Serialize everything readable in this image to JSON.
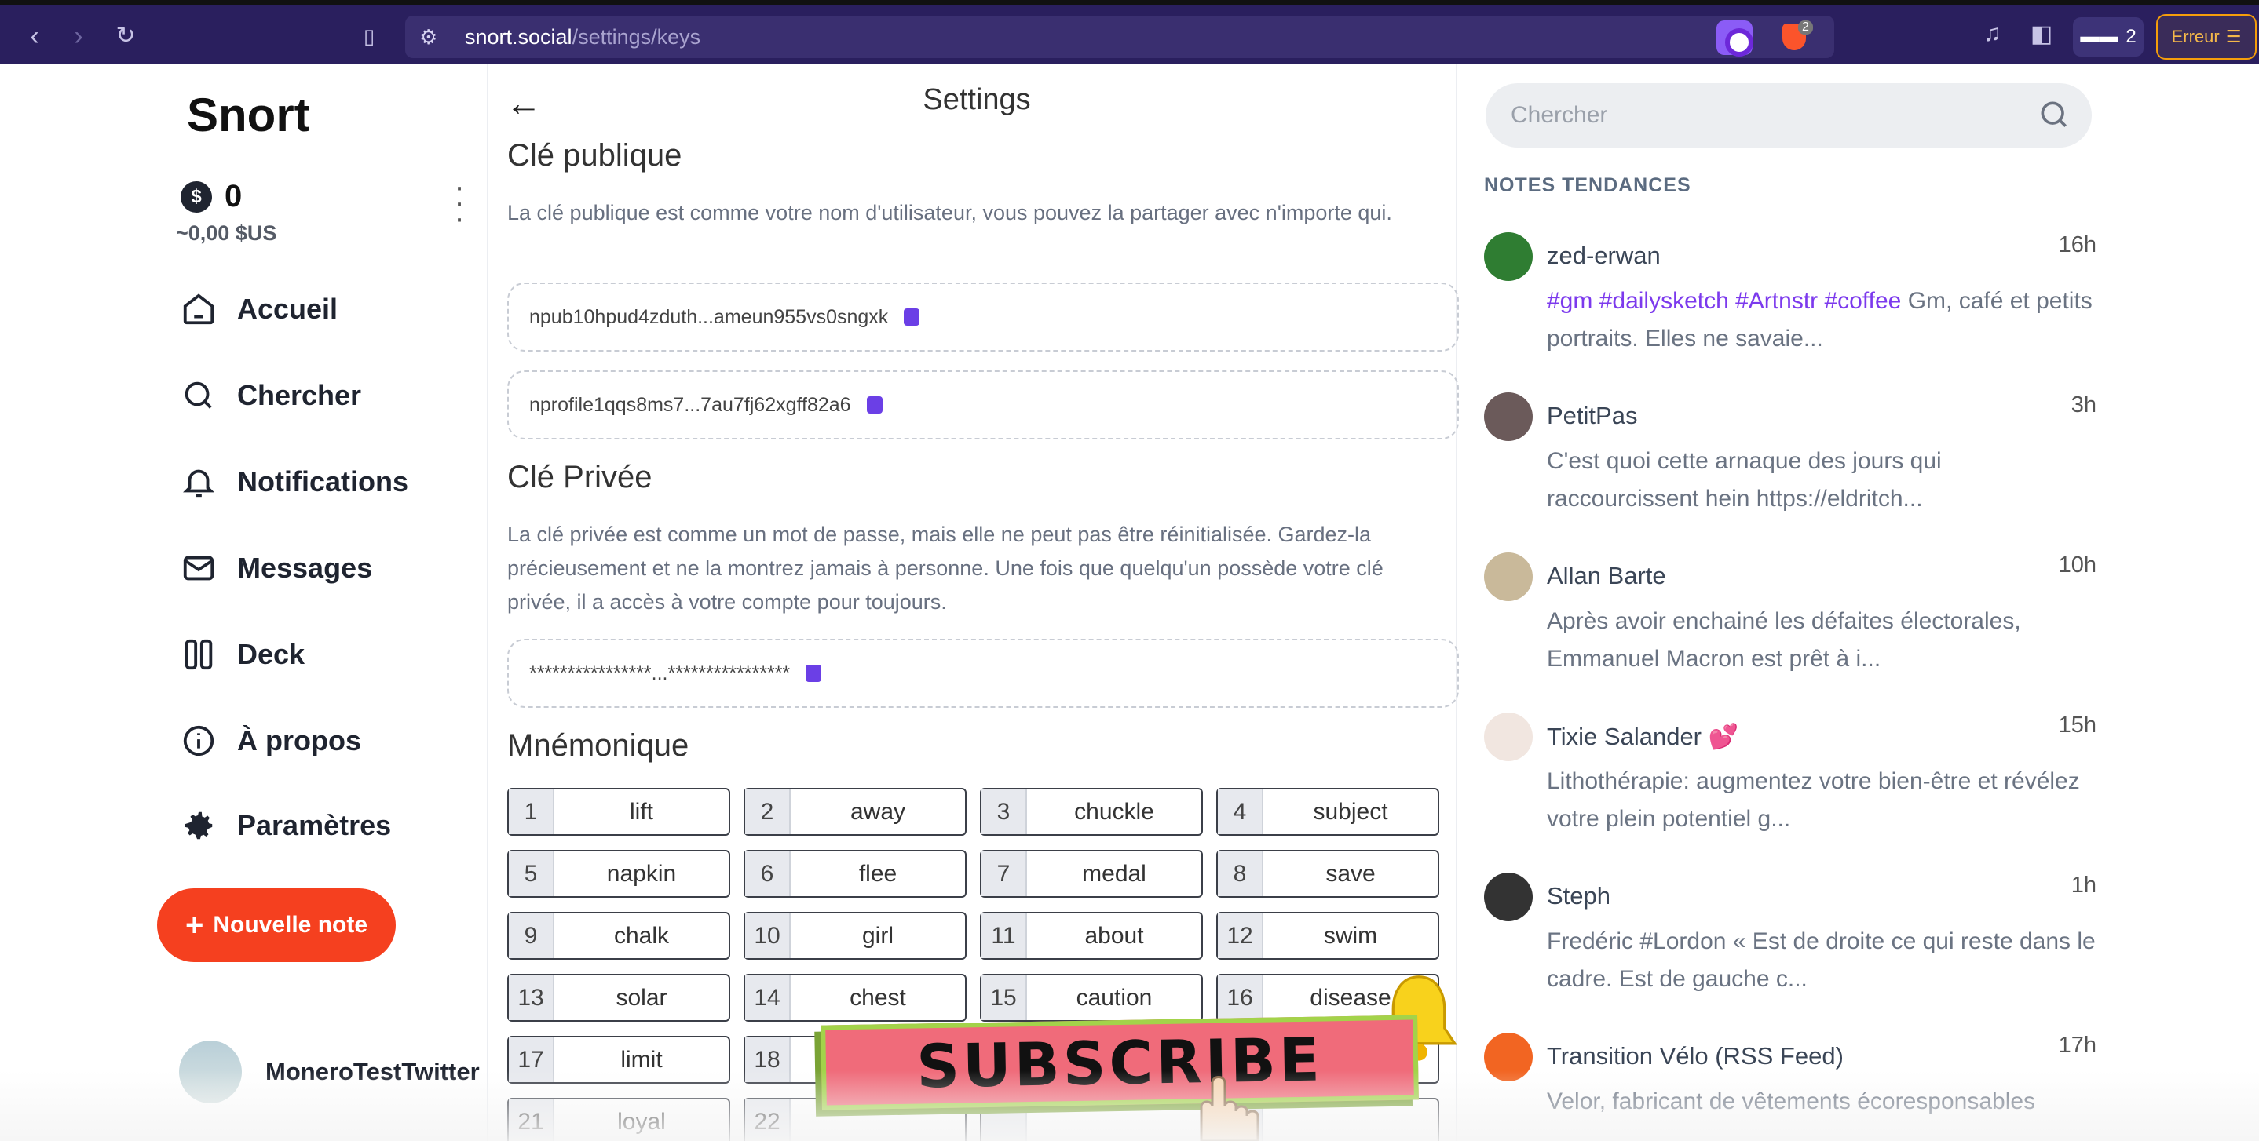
{
  "browser": {
    "url_host": "snort.social",
    "url_path": "/settings/keys",
    "brave_shield_count": "2",
    "wallet_count": "2",
    "error_label": "Erreur"
  },
  "sidebar": {
    "logo": "Snort",
    "balance": "0",
    "balance_fiat": "~0,00 $US",
    "items": [
      {
        "label": "Accueil",
        "icon": "home-icon"
      },
      {
        "label": "Chercher",
        "icon": "search-icon"
      },
      {
        "label": "Notifications",
        "icon": "bell-icon"
      },
      {
        "label": "Messages",
        "icon": "mail-icon"
      },
      {
        "label": "Deck",
        "icon": "columns-icon"
      },
      {
        "label": "À propos",
        "icon": "info-icon"
      },
      {
        "label": "Paramètres",
        "icon": "gear-icon"
      }
    ],
    "new_note_label": "Nouvelle note",
    "profile_name": "MoneroTestTwitter"
  },
  "main": {
    "title": "Settings",
    "public_key_heading": "Clé publique",
    "public_key_desc": "La clé publique est comme votre nom d'utilisateur, vous pouvez la partager avec n'importe qui.",
    "npub": "npub10hpud4zduth...ameun955vs0sngxk",
    "nprofile": "nprofile1qqs8ms7...7au7fj62xgff82a6",
    "private_key_heading": "Clé Privée",
    "private_key_desc": "La clé privée est comme un mot de passe, mais elle ne peut pas être réinitialisée. Gardez-la précieusement et ne la montrez jamais à personne. Une fois que quelqu'un possède votre clé privée, il a accès à votre compte pour toujours.",
    "nsec_masked": "****************...****************",
    "mnemonic_heading": "Mnémonique",
    "mnemonic": [
      {
        "n": "1",
        "w": "lift"
      },
      {
        "n": "2",
        "w": "away"
      },
      {
        "n": "3",
        "w": "chuckle"
      },
      {
        "n": "4",
        "w": "subject"
      },
      {
        "n": "5",
        "w": "napkin"
      },
      {
        "n": "6",
        "w": "flee"
      },
      {
        "n": "7",
        "w": "medal"
      },
      {
        "n": "8",
        "w": "save"
      },
      {
        "n": "9",
        "w": "chalk"
      },
      {
        "n": "10",
        "w": "girl"
      },
      {
        "n": "11",
        "w": "about"
      },
      {
        "n": "12",
        "w": "swim"
      },
      {
        "n": "13",
        "w": "solar"
      },
      {
        "n": "14",
        "w": "chest"
      },
      {
        "n": "15",
        "w": "caution"
      },
      {
        "n": "16",
        "w": "disease"
      },
      {
        "n": "17",
        "w": "limit"
      },
      {
        "n": "18",
        "w": ""
      },
      {
        "n": "",
        "w": ""
      },
      {
        "n": "",
        "w": ""
      },
      {
        "n": "21",
        "w": "loyal"
      },
      {
        "n": "22",
        "w": ""
      },
      {
        "n": "",
        "w": ""
      },
      {
        "n": "",
        "w": ""
      }
    ],
    "overlay_text": "SUBSCRIBE"
  },
  "right": {
    "search_placeholder": "Chercher",
    "trending_title": "NOTES TENDANCES",
    "notes": [
      {
        "author": "zed-erwan",
        "time": "16h",
        "tags": "#gm #dailysketch #Artnstr #coffee",
        "text": " Gm, café et petits portraits. Elles ne savaie...",
        "avatar_color": "#2f7d32"
      },
      {
        "author": "PetitPas",
        "time": "3h",
        "tags": "",
        "text": "C'est quoi cette arnaque des jours qui raccourcissent hein https://eldritch...",
        "avatar_color": "#6b5a5a"
      },
      {
        "author": "Allan Barte",
        "time": "10h",
        "tags": "",
        "text": "Après avoir enchainé les défaites électorales, Emmanuel Macron est prêt à i...",
        "avatar_color": "#c9b99a"
      },
      {
        "author": "Tixie Salander 💕",
        "time": "15h",
        "tags": "",
        "text": "Lithothérapie: augmentez votre bien-être et révélez votre plein potentiel g...",
        "avatar_color": "#f1e6e0"
      },
      {
        "author": "Steph",
        "time": "1h",
        "tags": "",
        "text": "Fredéric #Lordon « Est de droite ce qui reste dans le cadre. Est de gauche c...",
        "avatar_color": "#333333"
      },
      {
        "author": "Transition Vélo (RSS Feed)",
        "time": "17h",
        "tags": "",
        "text": "Velor, fabricant de vêtements écoresponsables",
        "avatar_color": "#f26522"
      }
    ]
  },
  "colors": {
    "chrome_bg": "#2a1f5e",
    "accent_orange": "#f5401f",
    "accent_purple": "#7c3aed"
  }
}
